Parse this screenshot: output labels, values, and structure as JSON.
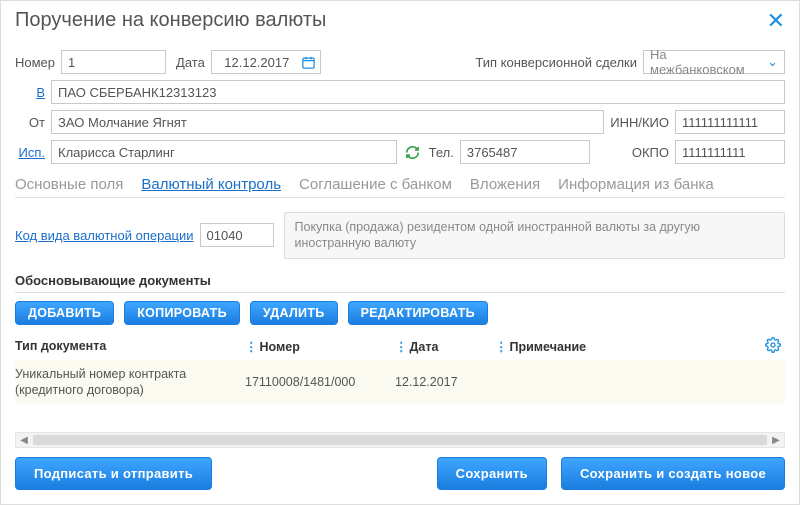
{
  "dialog": {
    "title": "Поручение на конверсию валюты"
  },
  "header": {
    "number_label": "Номер",
    "number_value": "1",
    "date_label": "Дата",
    "date_value": "12.12.2017",
    "deal_type_label": "Тип конверсионной сделки",
    "deal_type_value": "На межбанковском"
  },
  "party": {
    "to_label": "В",
    "to_value": "ПАО СБЕРБАНК12313123",
    "from_label": "От",
    "from_value": "ЗАО Молчание Ягнят",
    "inn_label": "ИНН/КИО",
    "inn_value": "111111111111",
    "okpo_label": "ОКПО",
    "okpo_value": "1111111111",
    "exec_label": "Исп.",
    "exec_value": "Кларисса Старлинг",
    "tel_label": "Тел.",
    "tel_value": "3765487"
  },
  "tabs": {
    "t0": "Основные поля",
    "t1": "Валютный контроль",
    "t2": "Соглашение с банком",
    "t3": "Вложения",
    "t4": "Информация из банка"
  },
  "op": {
    "code_label": "Код вида валютной операции",
    "code_value": "01040",
    "desc": "Покупка (продажа) резидентом одной иностранной валюты за другую иностранную валюту"
  },
  "docs": {
    "section_title": "Обосновывающие документы",
    "add": "ДОБАВИТЬ",
    "copy": "КОПИРОВАТЬ",
    "delete": "УДАЛИТЬ",
    "edit": "РЕДАКТИРОВАТЬ",
    "col_type": "Тип документа",
    "col_number": "Номер",
    "col_date": "Дата",
    "col_note": "Примечание",
    "row0": {
      "type": "Уникальный номер контракта (кредитного договора)",
      "number": "17110008/1481/000",
      "date": "12.12.2017",
      "note": ""
    }
  },
  "footer": {
    "sign_send": "Подписать и отправить",
    "save": "Сохранить",
    "save_new": "Сохранить и создать новое"
  }
}
